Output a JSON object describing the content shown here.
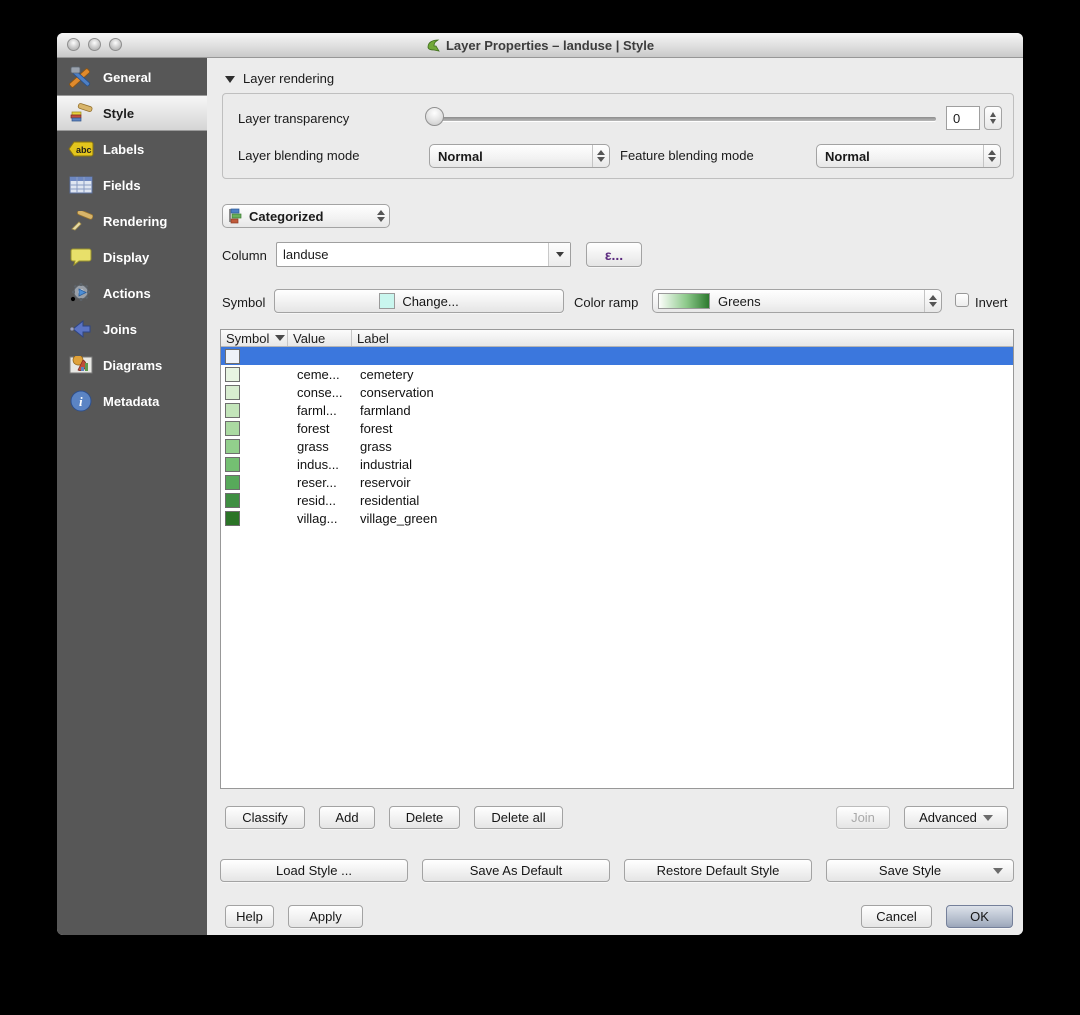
{
  "window": {
    "title": "Layer Properties – landuse | Style"
  },
  "sidebar": {
    "items": [
      {
        "label": "General",
        "icon": "tools-icon",
        "selected": false
      },
      {
        "label": "Style",
        "icon": "paintbrush-icon",
        "selected": true
      },
      {
        "label": "Labels",
        "icon": "abc-tag-icon",
        "selected": false
      },
      {
        "label": "Fields",
        "icon": "table-icon",
        "selected": false
      },
      {
        "label": "Rendering",
        "icon": "render-brush-icon",
        "selected": false
      },
      {
        "label": "Display",
        "icon": "speech-bubble-icon",
        "selected": false
      },
      {
        "label": "Actions",
        "icon": "gear-play-icon",
        "selected": false
      },
      {
        "label": "Joins",
        "icon": "join-arrow-icon",
        "selected": false
      },
      {
        "label": "Diagrams",
        "icon": "chart-icon",
        "selected": false
      },
      {
        "label": "Metadata",
        "icon": "info-icon",
        "selected": false
      }
    ]
  },
  "rendering": {
    "section_title": "Layer rendering",
    "transparency_label": "Layer transparency",
    "transparency_value": "0",
    "layer_blending_label": "Layer blending mode",
    "layer_blending_value": "Normal",
    "feature_blending_label": "Feature blending mode",
    "feature_blending_value": "Normal"
  },
  "style": {
    "renderer_type": "Categorized",
    "column_label": "Column",
    "column_value": "landuse",
    "expression_button": "ε...",
    "symbol_label": "Symbol",
    "symbol_change_label": "Change...",
    "symbol_color": "#c9f6ee",
    "color_ramp_label": "Color ramp",
    "color_ramp_value": "Greens",
    "invert_label": "Invert",
    "invert_checked": false
  },
  "table": {
    "columns": [
      "Symbol",
      "Value",
      "Label"
    ],
    "selection_color": "#3b77dd",
    "rows": [
      {
        "color": "#eef2f8",
        "value": "",
        "label": "",
        "selected": true
      },
      {
        "color": "#e7f4e1",
        "value": "ceme...",
        "label": "cemetery",
        "selected": false
      },
      {
        "color": "#d8edd0",
        "value": "conse...",
        "label": "conservation",
        "selected": false
      },
      {
        "color": "#c3e5ba",
        "value": "farml...",
        "label": "farmland",
        "selected": false
      },
      {
        "color": "#abdaa2",
        "value": "forest",
        "label": "forest",
        "selected": false
      },
      {
        "color": "#92cf8c",
        "value": "grass",
        "label": "grass",
        "selected": false
      },
      {
        "color": "#74bf72",
        "value": "indus...",
        "label": "industrial",
        "selected": false
      },
      {
        "color": "#57a95a",
        "value": "reser...",
        "label": "reservoir",
        "selected": false
      },
      {
        "color": "#3f8f42",
        "value": "resid...",
        "label": "residential",
        "selected": false
      },
      {
        "color": "#2b7427",
        "value": "villag...",
        "label": "village_green",
        "selected": false
      }
    ]
  },
  "buttons": {
    "classify": "Classify",
    "add": "Add",
    "delete": "Delete",
    "delete_all": "Delete all",
    "join": "Join",
    "advanced": "Advanced",
    "load_style": "Load Style ...",
    "save_as_default": "Save As Default",
    "restore_default": "Restore Default Style",
    "save_style": "Save Style",
    "help": "Help",
    "apply": "Apply",
    "cancel": "Cancel",
    "ok": "OK"
  },
  "colors": {
    "selection_blue": "#3b77dd",
    "sidebar_bg": "#575757",
    "ramp_gradient": [
      "#fcfefb",
      "#8cc98a",
      "#2d7a2f"
    ]
  }
}
